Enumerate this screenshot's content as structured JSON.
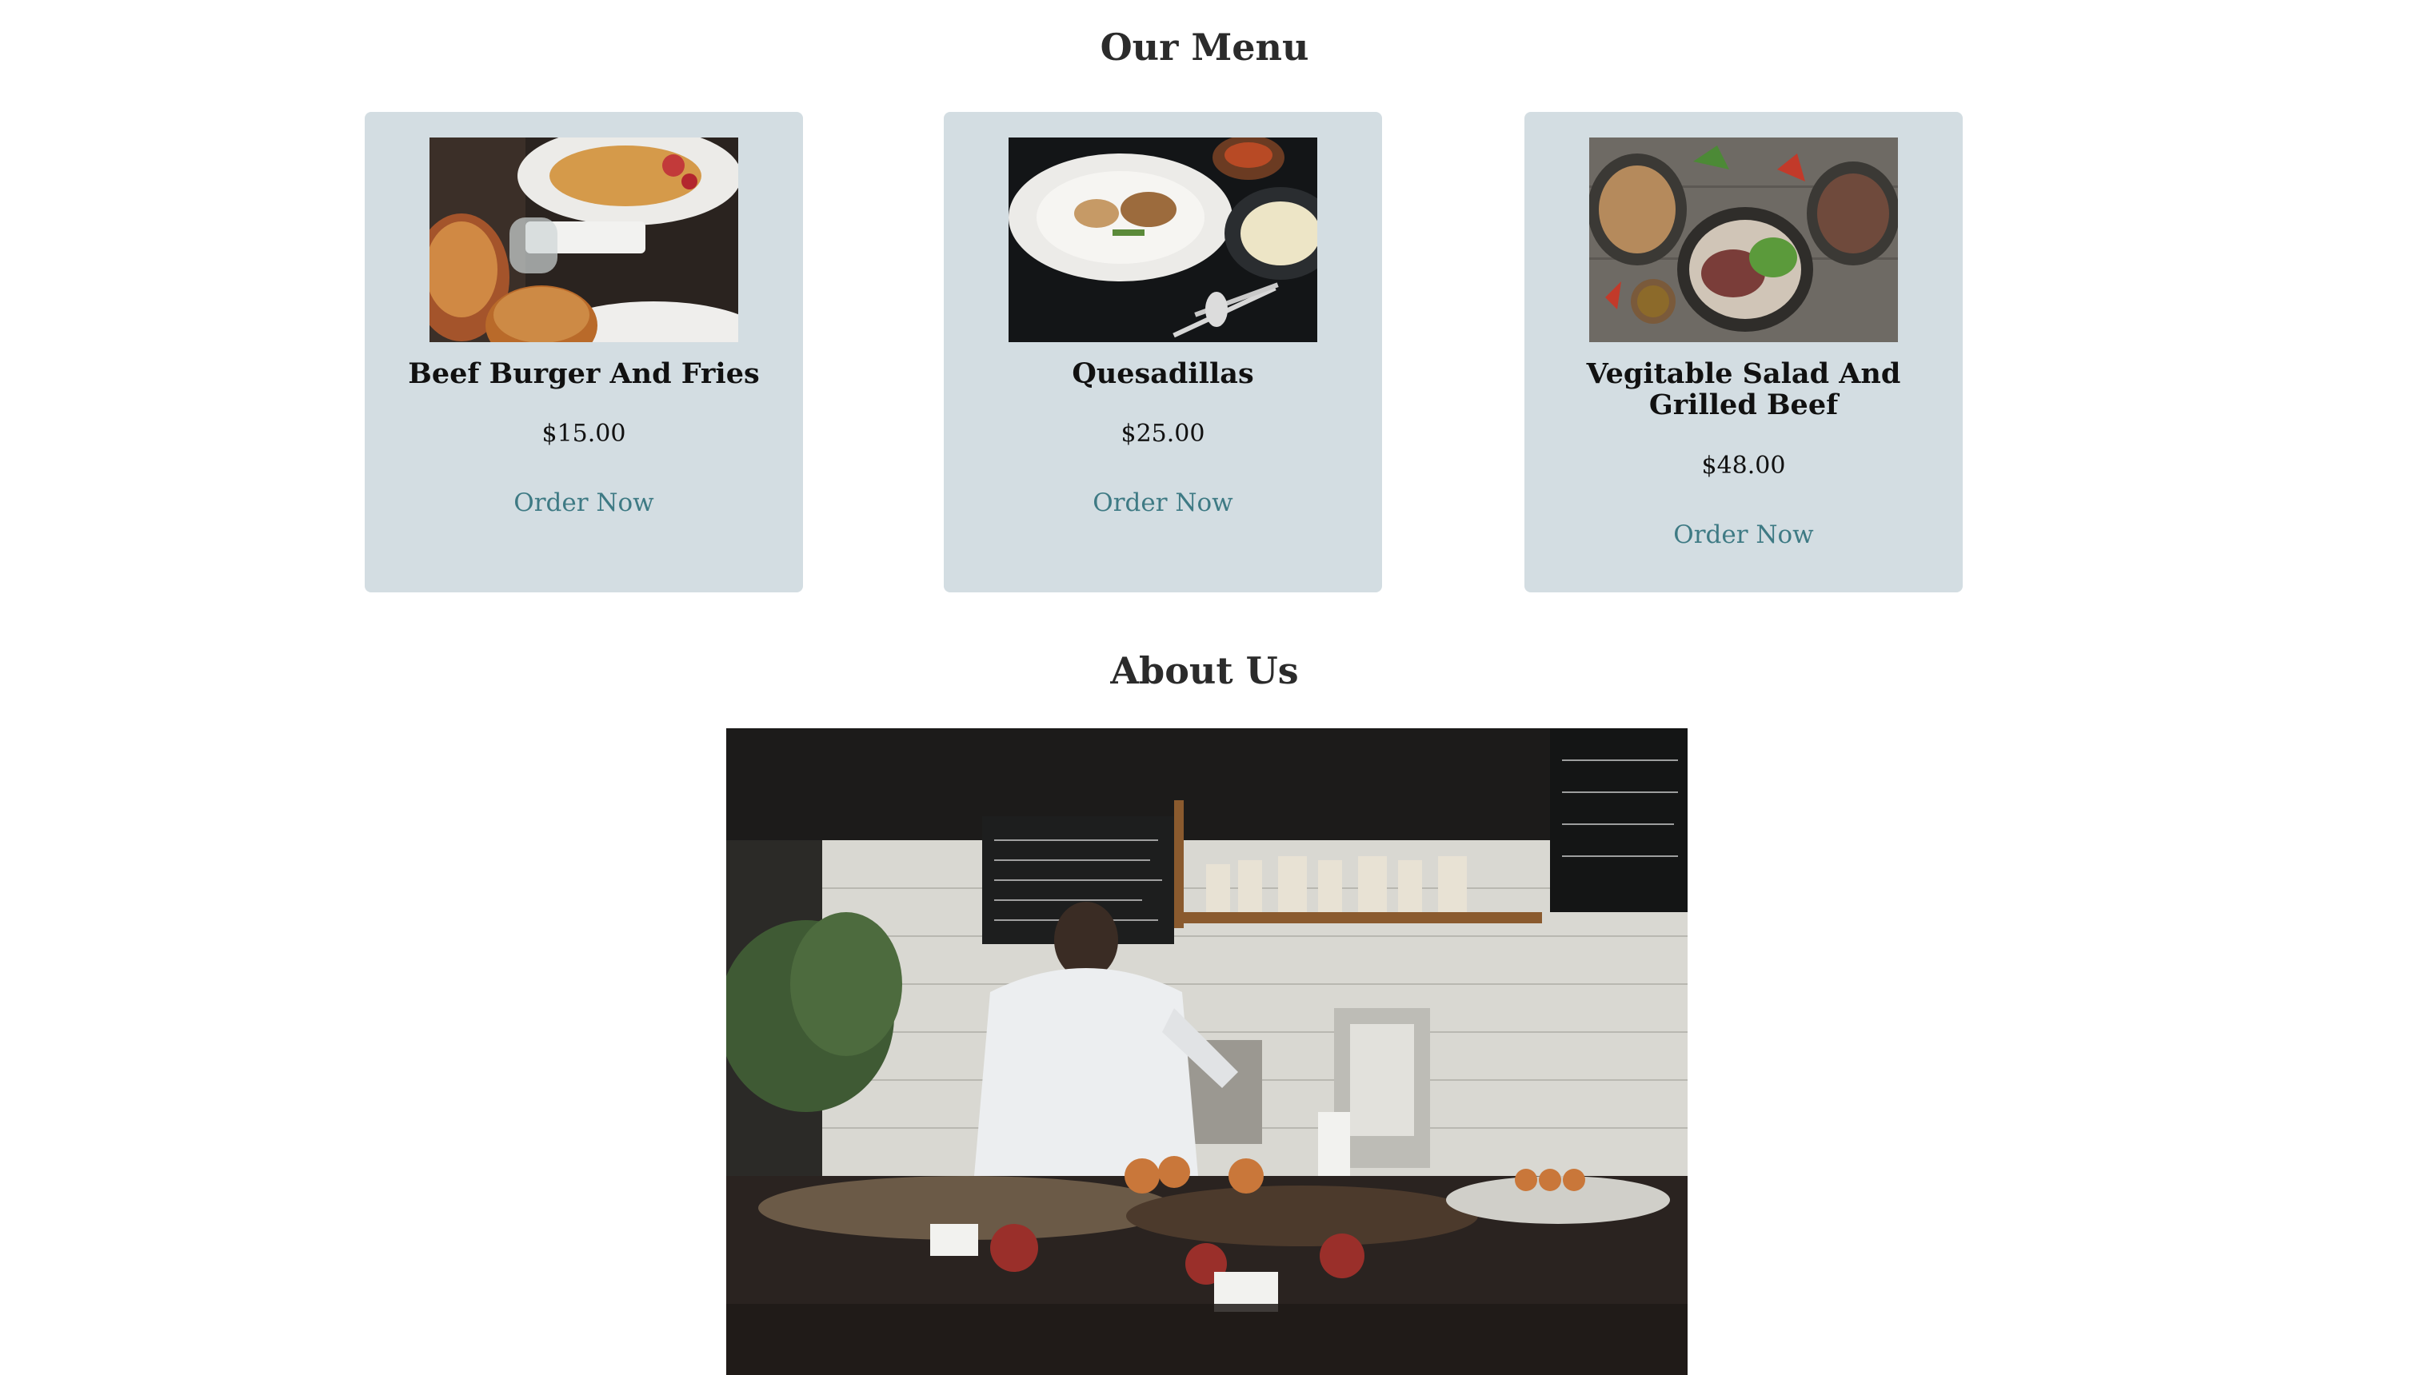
{
  "menu": {
    "title": "Our Menu",
    "items": [
      {
        "name": "Beef Burger And Fries",
        "price": "$15.00",
        "cta": "Order Now"
      },
      {
        "name": "Quesadillas",
        "price": "$25.00",
        "cta": "Order Now"
      },
      {
        "name": "Vegitable Salad And Grilled Beef",
        "price": "$48.00",
        "cta": "Order Now"
      }
    ]
  },
  "about": {
    "title": "About Us"
  },
  "colors": {
    "card_background": "#d3dde2",
    "link": "#3e7a84",
    "heading": "#2b2b2b"
  }
}
